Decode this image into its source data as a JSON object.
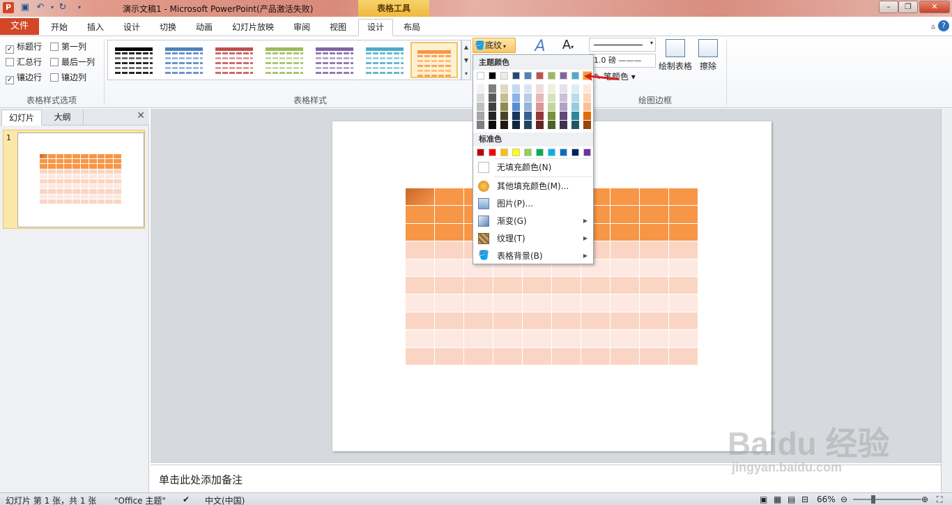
{
  "titlebar": {
    "title": "演示文稿1 - Microsoft PowerPoint(产品激活失败)",
    "context_tab": "表格工具"
  },
  "tabs": {
    "file": "文件",
    "items": [
      "开始",
      "插入",
      "设计",
      "切换",
      "动画",
      "幻灯片放映",
      "审阅",
      "视图",
      "设计",
      "布局"
    ],
    "active_index": 8
  },
  "ribbon": {
    "options_group": {
      "label": "表格样式选项",
      "checkboxes": [
        {
          "label": "标题行",
          "checked": true
        },
        {
          "label": "第一列",
          "checked": false
        },
        {
          "label": "汇总行",
          "checked": false
        },
        {
          "label": "最后一列",
          "checked": false
        },
        {
          "label": "镶边行",
          "checked": true
        },
        {
          "label": "镶边列",
          "checked": false
        }
      ]
    },
    "styles_group": {
      "label": "表格样式",
      "swatch_colors": [
        "#000000",
        "#4f81bd",
        "#c0504d",
        "#9bbb59",
        "#8064a2",
        "#4bacc6",
        "#f79646"
      ]
    },
    "shading_button": "底纹",
    "border_group": {
      "label": "绘图边框",
      "pen_weight": "1.0 磅",
      "pen_color": "笔颜色",
      "draw_table": "绘制表格",
      "eraser": "擦除"
    }
  },
  "shading_menu": {
    "theme_colors_label": "主题颜色",
    "standard_colors_label": "标准色",
    "theme_top_row": [
      "#ffffff",
      "#000000",
      "#eeece1",
      "#1f497d",
      "#4f81bd",
      "#c0504d",
      "#9bbb59",
      "#8064a2",
      "#4bacc6",
      "#f79646"
    ],
    "standard_colors": [
      "#c00000",
      "#ff0000",
      "#ffc000",
      "#ffff00",
      "#92d050",
      "#00b050",
      "#00b0f0",
      "#0070c0",
      "#002060",
      "#7030a0"
    ],
    "items": [
      {
        "label": "无填充颜色(N)",
        "icon": "no-fill-icon",
        "submenu": false
      },
      {
        "label": "其他填充颜色(M)...",
        "icon": "palette-icon",
        "submenu": false
      },
      {
        "label": "图片(P)...",
        "icon": "picture-icon",
        "submenu": false
      },
      {
        "label": "渐变(G)",
        "icon": "gradient-icon",
        "submenu": true
      },
      {
        "label": "纹理(T)",
        "icon": "texture-icon",
        "submenu": true
      },
      {
        "label": "表格背景(B)",
        "icon": "table-background-icon",
        "submenu": true
      }
    ]
  },
  "left_panel": {
    "tab_slides": "幻灯片",
    "tab_outline": "大纲",
    "slide_number": "1"
  },
  "notes": {
    "placeholder": "单击此处添加备注"
  },
  "statusbar": {
    "slide_info": "幻灯片 第 1 张，共 1 张",
    "theme": "\"Office 主题\"",
    "language": "中文(中国)",
    "zoom": "66%"
  },
  "watermark": {
    "brand": "Baidu 经验",
    "url": "jingyan.baidu.com"
  },
  "colors": {
    "accent_orange": "#f79646",
    "band_light": "#fbd5c4",
    "band_lighter": "#fde9e1",
    "file_tab": "#d24726"
  }
}
